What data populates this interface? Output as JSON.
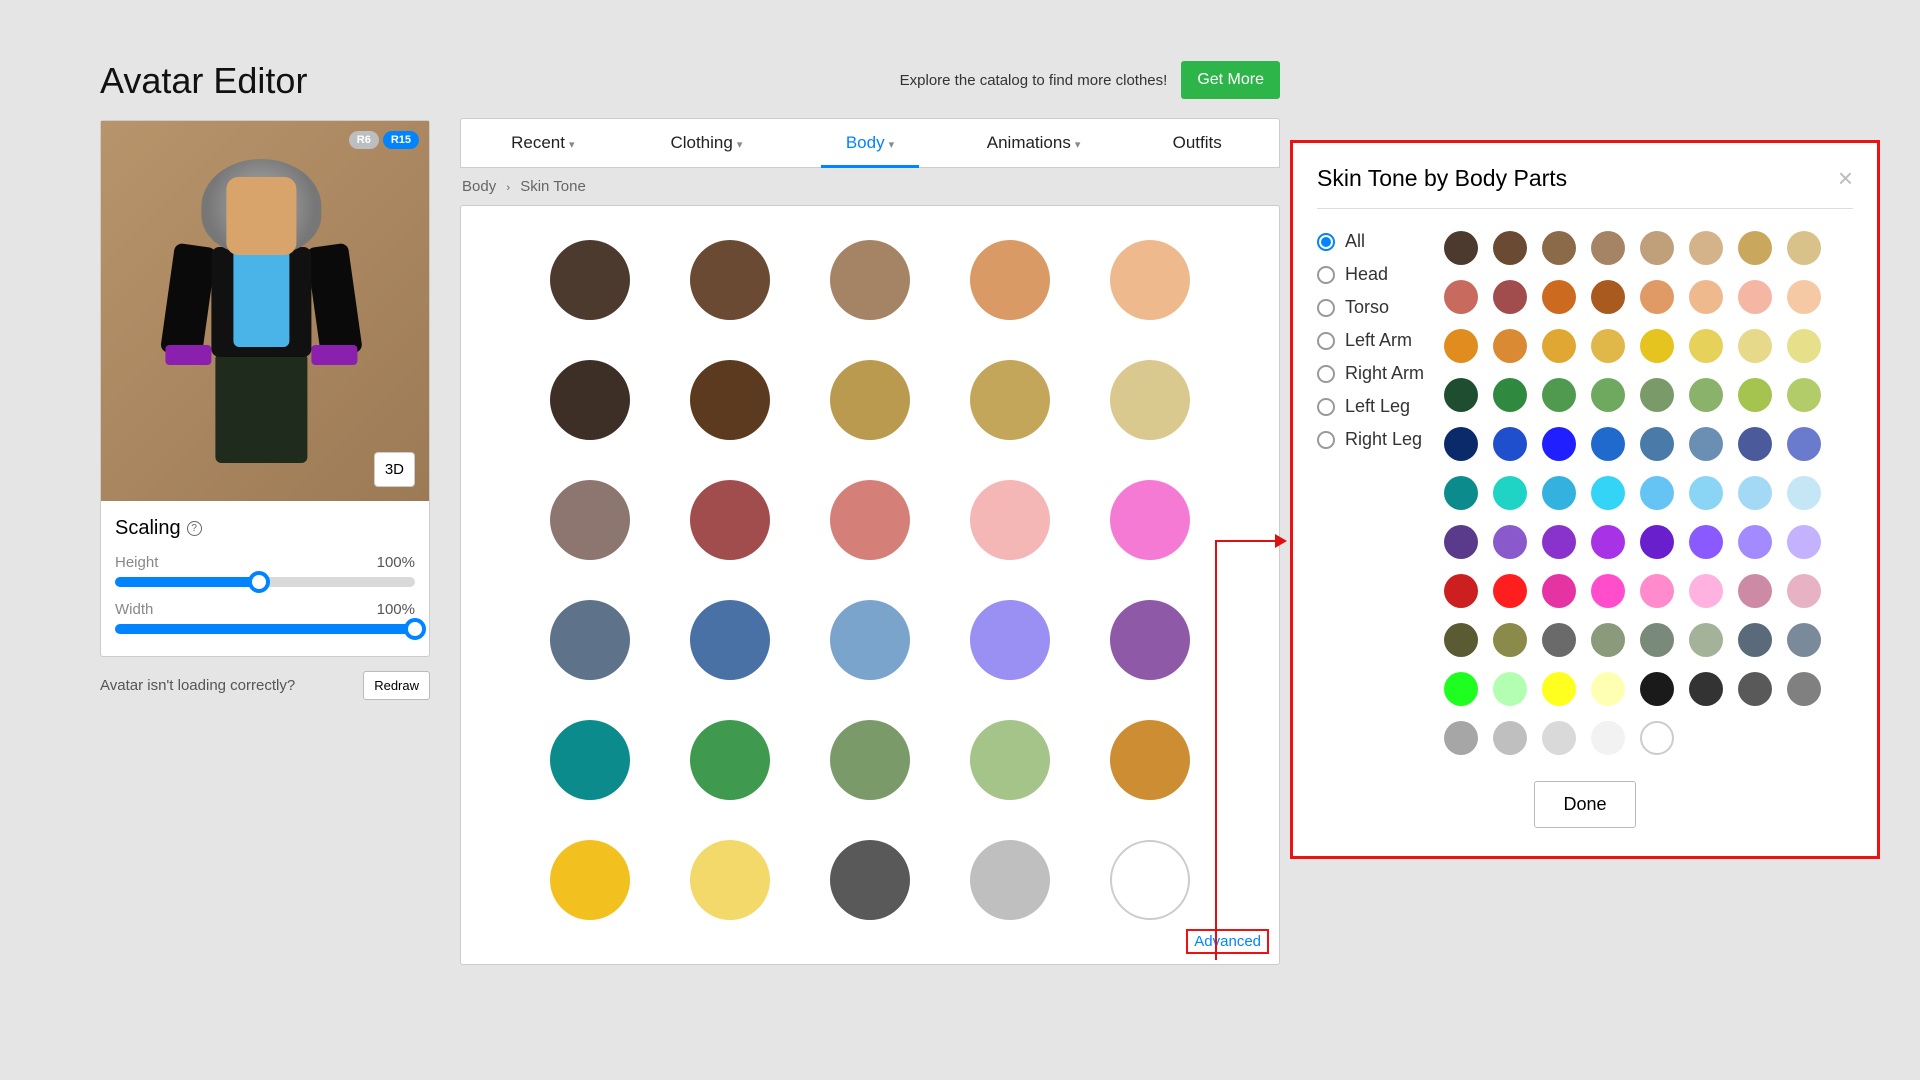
{
  "page_title": "Avatar Editor",
  "rig": {
    "r6": "R6",
    "r15": "R15"
  },
  "btn_3d": "3D",
  "scaling": {
    "title": "Scaling",
    "height_label": "Height",
    "height_value": "100%",
    "height_fill": 48,
    "width_label": "Width",
    "width_value": "100%",
    "width_fill": 100
  },
  "redraw": {
    "text": "Avatar isn't loading correctly?",
    "button": "Redraw"
  },
  "explore_text": "Explore the catalog to find more clothes!",
  "get_more": "Get More",
  "tabs": [
    {
      "label": "Recent",
      "chev": true
    },
    {
      "label": "Clothing",
      "chev": true
    },
    {
      "label": "Body",
      "chev": true,
      "active": true
    },
    {
      "label": "Animations",
      "chev": true
    },
    {
      "label": "Outfits",
      "chev": false
    }
  ],
  "breadcrumb": {
    "root": "Body",
    "leaf": "Skin Tone"
  },
  "swatches": [
    "#4d3a2f",
    "#6a4a33",
    "#a58465",
    "#d99a65",
    "#efb98e",
    "#3e2f26",
    "#5b3a1f",
    "#b99a4f",
    "#c4a65a",
    "#d9c98f",
    "#8d7570",
    "#a14d4d",
    "#d48079",
    "#f5b6b6",
    "#f57ad4",
    "#5e7289",
    "#4971a5",
    "#7aa4cc",
    "#9a8ff2",
    "#8e5aa8",
    "#0b8b8b",
    "#3f9a4f",
    "#7a9a6a",
    "#a4c48a",
    "#cc8d33",
    "#f2c11f",
    "#f2d96a",
    "#595959",
    "#bfbfbf",
    "hollow"
  ],
  "advanced": "Advanced",
  "modal": {
    "title": "Skin Tone by Body Parts",
    "parts": [
      "All",
      "Head",
      "Torso",
      "Left Arm",
      "Right Arm",
      "Left Leg",
      "Right Leg"
    ],
    "selected": 0,
    "done": "Done",
    "colors": [
      "#4d3a2f",
      "#6a4a33",
      "#8b6a4a",
      "#a58465",
      "#bfa07a",
      "#d4b38a",
      "#c9a85e",
      "#d9c28a",
      "#c96a5e",
      "#a14d4d",
      "#cc6a1f",
      "#a85a1f",
      "#e09a65",
      "#efb98e",
      "#f5b6a4",
      "#f5c9a4",
      "#e08c1f",
      "#d98a33",
      "#e0a833",
      "#e0b84a",
      "#e6c41f",
      "#e6d15a",
      "#e6d98a",
      "#e6e08a",
      "#1f4d2f",
      "#2f8a3f",
      "#4f9a4f",
      "#6fa85f",
      "#7a9a6a",
      "#8ab26a",
      "#a4c44f",
      "#b2cc6a",
      "#0b2a6a",
      "#1f4fcc",
      "#1f1fff",
      "#1f6acc",
      "#4a7aa8",
      "#6a8fb2",
      "#4a5a9a",
      "#6a7acc",
      "#0b8b8b",
      "#1fd4c4",
      "#33b2e0",
      "#33d4f5",
      "#66c4f5",
      "#8ad4f5",
      "#a4d9f5",
      "#c4e6f5",
      "#5a3a8a",
      "#8a5acc",
      "#8a33cc",
      "#a833e6",
      "#6a1fcc",
      "#8a5aff",
      "#a48aff",
      "#c4b2ff",
      "#cc1f1f",
      "#ff1f1f",
      "#e633a4",
      "#ff4dcc",
      "#ff8acc",
      "#ffb2e0",
      "#cc8aa4",
      "#e6b2c4",
      "#5a5a33",
      "#8a8a4a",
      "#6a6a6a",
      "#8a9a7a",
      "#7a8a7a",
      "#a4b29a",
      "#5a6a7a",
      "#7a8a9a",
      "#1fff1f",
      "#b2ffb2",
      "#ffff1f",
      "#ffffb2",
      "#1a1a1a",
      "#333333",
      "#595959",
      "#808080",
      "#a6a6a6",
      "#bfbfbf",
      "#d9d9d9",
      "#f2f2f2",
      "hollow"
    ]
  }
}
